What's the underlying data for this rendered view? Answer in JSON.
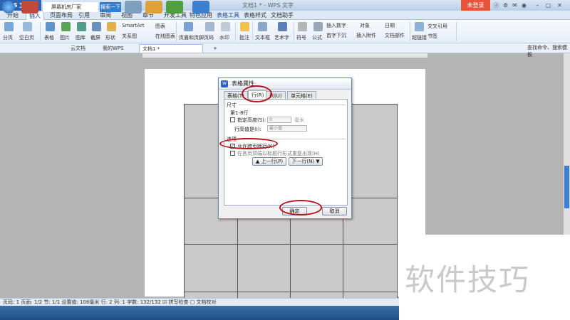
{
  "window": {
    "app_button": "WPS 文字",
    "title": "文档1 * - WPS 文字",
    "login": "未登录",
    "controls": [
      "ⓐ",
      "⚙",
      "✉",
      "◉",
      "–",
      "▢",
      "✕"
    ]
  },
  "ribbon_tabs": [
    "开始",
    "插入",
    "页面布局",
    "引用",
    "审阅",
    "视图",
    "章节",
    "开发工具",
    "特色应用",
    "表格工具",
    "表格样式",
    "文档助手"
  ],
  "ribbon": {
    "items": [
      "分页",
      "空白页",
      "表格",
      "图片",
      "图库",
      "截屏",
      "形状",
      "SmartArt",
      "关系图",
      "图表",
      "在线图表",
      "页眉和页脚",
      "页码",
      "水印",
      "批注",
      "文本框",
      "艺术字",
      "符号",
      "公式",
      "插入数字",
      "对象",
      "日期",
      "首字下沉",
      "插入附件",
      "文档部件",
      "超链接",
      "交叉引用",
      "书签"
    ]
  },
  "doc_tabs": {
    "items": [
      "云文档",
      "我的WPS",
      "文档1 *"
    ],
    "add": "+",
    "search": "查找命令、搜索模板"
  },
  "dialog": {
    "title": "表格属性",
    "tabs": [
      "表格(T)",
      "行(R)",
      "列(U)",
      "单元格(E)"
    ],
    "size_group": "尺寸",
    "row_label": "第1-8行",
    "specify_height": "指定高度(S):",
    "height_value": "0",
    "unit": "毫米",
    "row_height_mode_label": "行高值是(I):",
    "row_height_mode": "最小值",
    "options_group": "选项",
    "allow_break": "允许跨页断行(K)",
    "repeat_header": "在各页顶端以标题行形式重复出现(H)",
    "prev_row": "▲ 上一行(P)",
    "next_row": "下一行(N) ▼",
    "ok": "确定",
    "cancel": "取消"
  },
  "statusbar": "页码: 1   页面: 1/2   节: 1/1   设置值: 108毫米   行: 2   列: 1   字数: 132/132   ☑ 拼写检查   □ 文档校对",
  "taskbar": {
    "input": "屏幕机房厂家",
    "search_button": "搜索一下"
  },
  "watermark": "软件技巧"
}
